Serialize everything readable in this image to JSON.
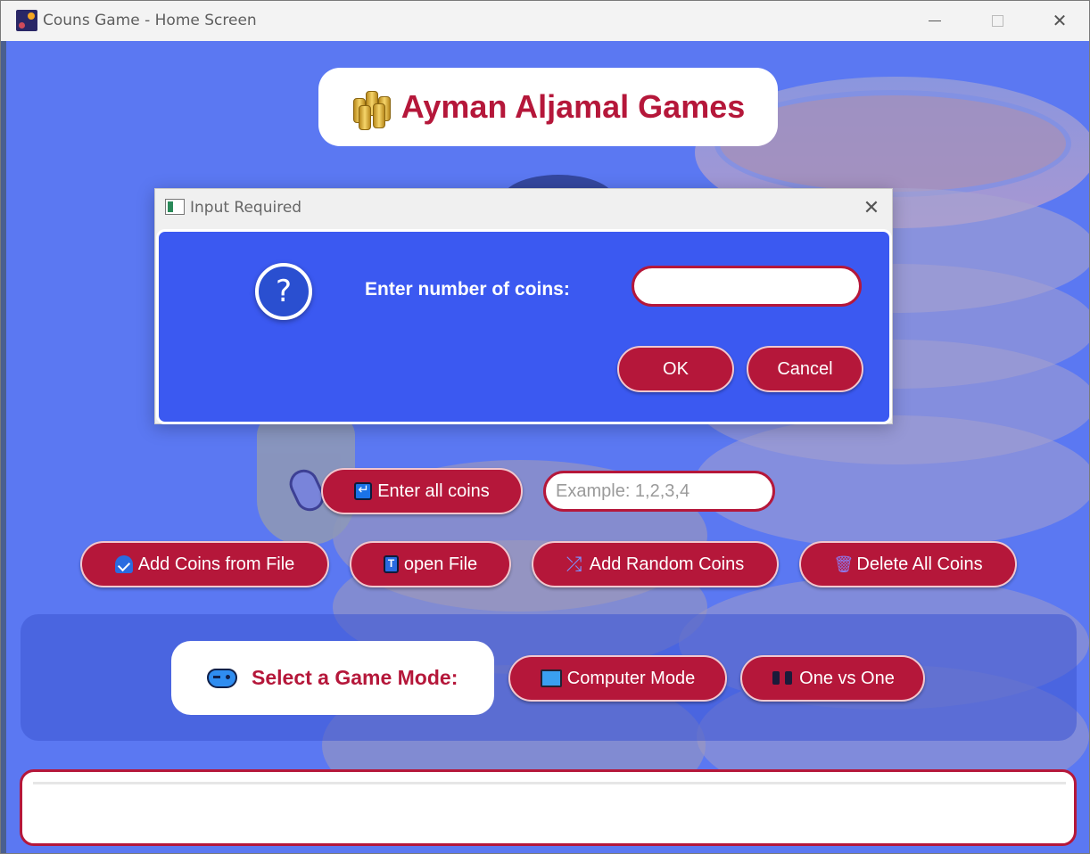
{
  "window": {
    "title": "Couns Game - Home Screen",
    "minimize": "—",
    "close": "✕"
  },
  "header": {
    "title": "Ayman Aljamal Games",
    "icon": "gold-coins-icon"
  },
  "dialog": {
    "title": "Input Required",
    "close": "✕",
    "icon": "question-icon",
    "icon_glyph": "?",
    "prompt": "Enter number of coins:",
    "input_value": "",
    "ok_label": "OK",
    "cancel_label": "Cancel"
  },
  "coins_entry": {
    "enter_all_label": "Enter all coins",
    "placeholder": "Example: 1,2,3,4"
  },
  "actions": {
    "add_from_file": "Add Coins from File",
    "open_file": "open File",
    "add_random": "Add Random Coins",
    "delete_all": "Delete All Coins",
    "shuffle_glyph": "⤮",
    "trash_glyph": "🗑"
  },
  "mode": {
    "label": "Select a Game Mode:",
    "computer_mode": "Computer Mode",
    "one_vs_one": "One vs One"
  },
  "colors": {
    "background": "#5b78f2",
    "accent": "#b5173a",
    "dialog_body": "#3b59f1"
  }
}
